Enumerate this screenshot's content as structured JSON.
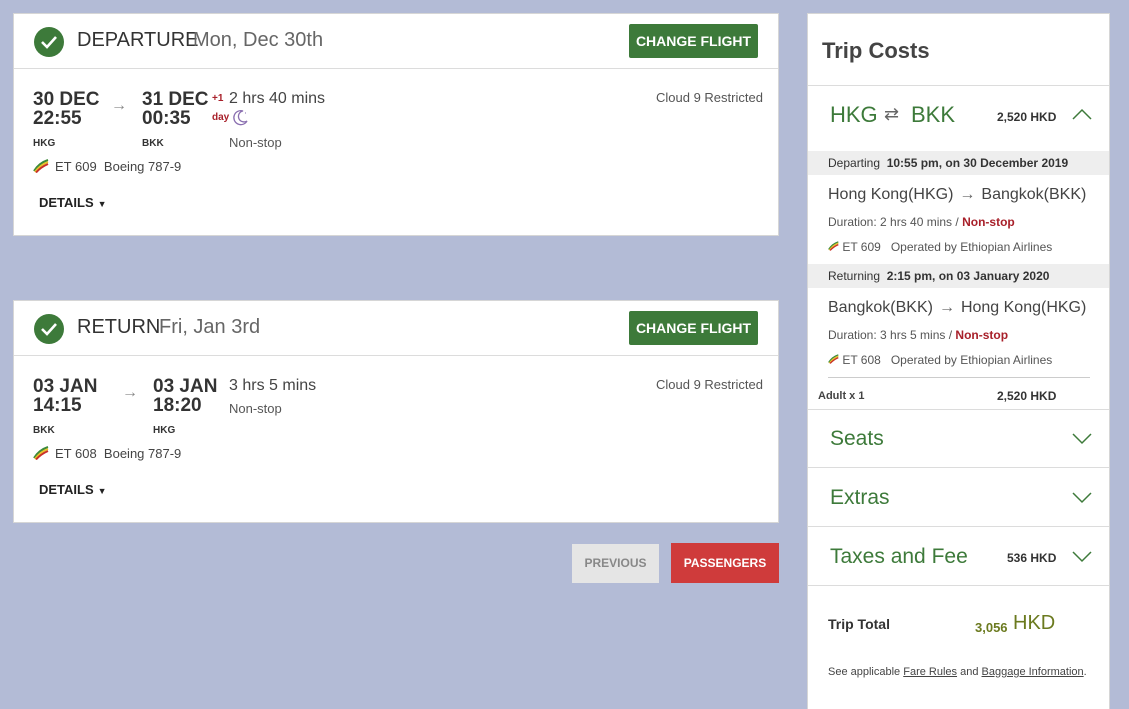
{
  "departure": {
    "label": "DEPARTURE",
    "date": "Mon, Dec 30th",
    "change_label": "CHANGE FLIGHT",
    "dep_date": "30 DEC",
    "dep_time": "22:55",
    "dep_code": "HKG",
    "arr_date": "31 DEC",
    "arr_time": "00:35",
    "arr_code": "BKK",
    "plus_day_1": "+1",
    "plus_day_2": "day",
    "duration": "2 hrs 40 mins",
    "stops": "Non-stop",
    "fare": "Cloud 9 Restricted",
    "flight": "ET 609",
    "aircraft": "Boeing 787-9",
    "details_label": "DETAILS"
  },
  "return": {
    "label": "RETURN",
    "date": "Fri, Jan 3rd",
    "change_label": "CHANGE FLIGHT",
    "dep_date": "03 JAN",
    "dep_time": "14:15",
    "dep_code": "BKK",
    "arr_date": "03 JAN",
    "arr_time": "18:20",
    "arr_code": "HKG",
    "duration": "3 hrs 5 mins",
    "stops": "Non-stop",
    "fare": "Cloud 9 Restricted",
    "flight": "ET 608",
    "aircraft": "Boeing 787-9",
    "details_label": "DETAILS"
  },
  "nav": {
    "previous_label": "PREVIOUS",
    "passengers_label": "PASSENGERS"
  },
  "trip_costs": {
    "title": "Trip Costs",
    "route_from": "HKG",
    "route_to": "BKK",
    "route_amount": "2,520 HKD",
    "departing_label": "Departing",
    "departing_when": "10:55 pm, on 30 December 2019",
    "out_from": "Hong Kong(HKG)",
    "out_to": "Bangkok(BKK)",
    "out_duration": "Duration: 2 hrs 40 mins /",
    "out_stops": "Non-stop",
    "out_flight": "ET 609",
    "out_operator": "Operated by Ethiopian Airlines",
    "returning_label": "Returning",
    "returning_when": "2:15 pm, on 03 January 2020",
    "ret_from": "Bangkok(BKK)",
    "ret_to": "Hong Kong(HKG)",
    "ret_duration": "Duration: 3 hrs 5 mins /",
    "ret_stops": "Non-stop",
    "ret_flight": "ET 608",
    "ret_operator": "Operated by Ethiopian Airlines",
    "adult_label": "Adult x 1",
    "adult_amount": "2,520 HKD",
    "seats_label": "Seats",
    "extras_label": "Extras",
    "taxes_label": "Taxes and Fee",
    "taxes_amount": "536 HKD",
    "total_label": "Trip Total",
    "total_value": "3,056",
    "total_currency": "HKD",
    "rules_prefix": "See applicable",
    "fare_rules_link": "Fare Rules",
    "rules_and": "and",
    "baggage_link": "Baggage Information",
    "rules_suffix": "."
  },
  "colors": {
    "accent_green": "#3d7a3a",
    "cta_red": "#cf3b3b",
    "page_bg": "#b3bbd6",
    "nonstop_red": "#a8202a"
  },
  "icons": [
    "check-icon",
    "arrow-right-icon",
    "moon-icon",
    "airline-logo-icon",
    "caret-down-icon",
    "swap-icon",
    "chevron-up-icon",
    "chevron-down-icon"
  ]
}
